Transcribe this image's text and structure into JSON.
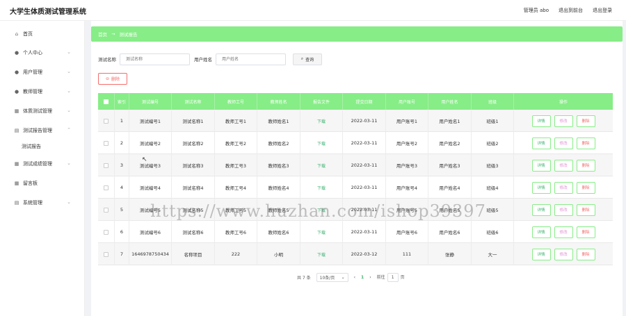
{
  "app_title": "大学生体质测试管理系统",
  "topbar": {
    "user_label": "管理员 abo",
    "exit_frontend": "退出到前台",
    "logout": "退出登录"
  },
  "sidebar": {
    "items": [
      {
        "label": "首页",
        "icon": "home-icon"
      },
      {
        "label": "个人中心",
        "icon": "user-icon"
      },
      {
        "label": "用户管理",
        "icon": "users-icon"
      },
      {
        "label": "教师管理",
        "icon": "teacher-icon"
      },
      {
        "label": "体质测试管理",
        "icon": "grid-icon"
      },
      {
        "label": "测试报告管理",
        "icon": "report-icon"
      },
      {
        "label": "测试成绩管理",
        "icon": "grid-icon"
      },
      {
        "label": "留言板",
        "icon": "grid-icon"
      },
      {
        "label": "系统管理",
        "icon": "system-icon"
      }
    ],
    "sub_item": "测试报告"
  },
  "breadcrumb": {
    "home": "首页",
    "sep": "→",
    "current": "测试报告"
  },
  "search": {
    "name_label": "测试名称",
    "name_placeholder": "测试名称",
    "user_label": "用户姓名",
    "user_placeholder": "用户姓名",
    "button": "查询"
  },
  "delete_button": "删除",
  "table": {
    "headers": [
      "",
      "索引",
      "测试编号",
      "测试名称",
      "教师工号",
      "教师姓名",
      "报告文件",
      "提交日期",
      "用户账号",
      "用户姓名",
      "班级",
      "操作"
    ],
    "rows": [
      {
        "idx": "1",
        "code": "测试编号1",
        "name": "测试名称1",
        "tno": "教师工号1",
        "tname": "教师姓名1",
        "file": "下载",
        "date": "2022-03-11",
        "uacc": "用户账号1",
        "uname": "用户姓名1",
        "cls": "班级1"
      },
      {
        "idx": "2",
        "code": "测试编号2",
        "name": "测试名称2",
        "tno": "教师工号2",
        "tname": "教师姓名2",
        "file": "下载",
        "date": "2022-03-11",
        "uacc": "用户账号2",
        "uname": "用户姓名2",
        "cls": "班级2"
      },
      {
        "idx": "3",
        "code": "测试编号3",
        "name": "测试名称3",
        "tno": "教师工号3",
        "tname": "教师姓名3",
        "file": "下载",
        "date": "2022-03-11",
        "uacc": "用户账号3",
        "uname": "用户姓名3",
        "cls": "班级3"
      },
      {
        "idx": "4",
        "code": "测试编号4",
        "name": "测试名称4",
        "tno": "教师工号4",
        "tname": "教师姓名4",
        "file": "下载",
        "date": "2022-03-11",
        "uacc": "用户账号4",
        "uname": "用户姓名4",
        "cls": "班级4"
      },
      {
        "idx": "5",
        "code": "测试编号5",
        "name": "测试名称5",
        "tno": "教师工号5",
        "tname": "教师姓名5",
        "file": "下载",
        "date": "2022-03-11",
        "uacc": "用户账号5",
        "uname": "用户姓名5",
        "cls": "班级5"
      },
      {
        "idx": "6",
        "code": "测试编号6",
        "name": "测试名称6",
        "tno": "教师工号6",
        "tname": "教师姓名6",
        "file": "下载",
        "date": "2022-03-11",
        "uacc": "用户账号6",
        "uname": "用户姓名6",
        "cls": "班级6"
      },
      {
        "idx": "7",
        "code": "1646978750434",
        "name": "名称项目",
        "tno": "222",
        "tname": "小明",
        "file": "下载",
        "date": "2022-03-12",
        "uacc": "111",
        "uname": "张静",
        "cls": "大一"
      }
    ],
    "actions": {
      "detail": "详情",
      "edit": "修改",
      "delete": "删除"
    }
  },
  "pagination": {
    "total": "共 7 条",
    "page_size": "10条/页",
    "prev": "‹",
    "current": "1",
    "next": "›",
    "goto_prefix": "前往",
    "goto_value": "1",
    "goto_suffix": "页"
  },
  "watermark": "https://www.huzhan.com/ishop39397",
  "colors": {
    "accent": "#87ed87",
    "danger": "#f56c6c",
    "link": "#3cb371"
  }
}
